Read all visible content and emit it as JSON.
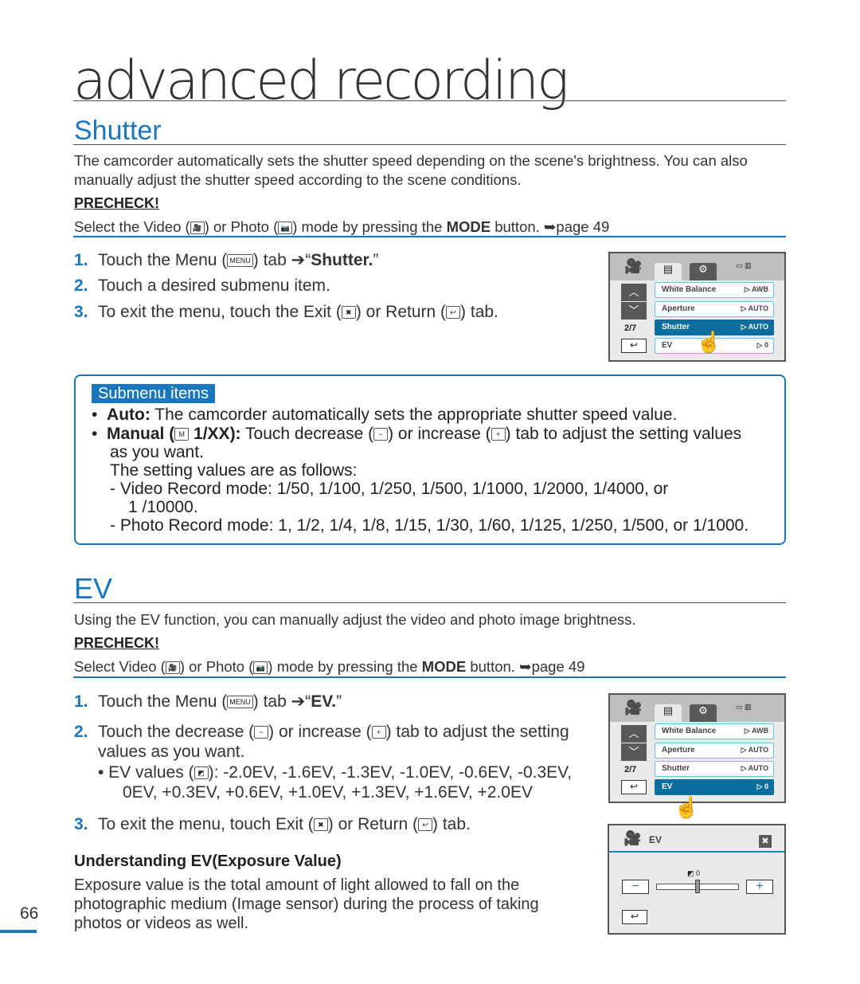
{
  "chapter_title": "advanced recording",
  "shutter": {
    "title": "Shutter",
    "intro": "The camcorder automatically sets the shutter speed depending on the scene's brightness. You can also manually adjust the shutter speed according to the scene conditions.",
    "precheck_label": "PRECHECK!",
    "precheck": {
      "a": "Select the Video (",
      "b": ") or Photo (",
      "c": ") mode by pressing the ",
      "mode": "MODE",
      "d": " button. ➥page 49"
    },
    "steps": [
      {
        "num": "1.",
        "a": "Touch the Menu (",
        "icon": "MENU",
        "b": ") tab ➔“",
        "bold": "Shutter.",
        "c": "”"
      },
      {
        "num": "2.",
        "text": "Touch a desired submenu item."
      },
      {
        "num": "3.",
        "a": "To exit the menu, touch the Exit (",
        "b": ") or Return (",
        "c": ") tab."
      }
    ],
    "submenu_label": "Submenu items",
    "auto_label": "Auto:",
    "auto_text": " The camcorder automatically sets the appropriate shutter speed value.",
    "manual_label": "Manual (",
    "manual_mid": " 1/XX):",
    "manual_text": " Touch decrease (",
    "manual_text2": ") or increase (",
    "manual_text3": ") tab to adjust the setting values",
    "manual_line2": "as you want.",
    "manual_line3": "The setting values are as follows:",
    "video_values": "-  Video Record mode: 1/50, 1/100, 1/250, 1/500, 1/1000, 1/2000, 1/4000, or",
    "video_values2": "1 /10000.",
    "photo_values": "-  Photo Record mode: 1, 1/2, 1/4, 1/8, 1/15, 1/30, 1/60, 1/125, 1/250, 1/500, or 1/1000."
  },
  "ev": {
    "title": "EV",
    "intro": "Using the EV function, you can manually adjust the video and photo image brightness.",
    "precheck_label": "PRECHECK!",
    "precheck": {
      "a": "Select Video (",
      "b": ") or Photo (",
      "c": ") mode by pressing the ",
      "mode": "MODE",
      "d": " button. ➥page 49"
    },
    "step1": {
      "num": "1.",
      "a": "Touch the Menu (",
      "icon": "MENU",
      "b": ") tab ➔“",
      "bold": "EV.",
      "c": "”"
    },
    "step2": {
      "num": "2.",
      "a": "Touch the decrease (",
      "b": ") or increase (",
      "c": ") tab to adjust the setting",
      "d": "values as you want."
    },
    "ev_values_a": "•   EV values (",
    "ev_values_b": "): -2.0EV, -1.6EV, -1.3EV, -1.0EV, -0.6EV, -0.3EV,",
    "ev_values_c": "0EV, +0.3EV, +0.6EV, +1.0EV, +1.3EV, +1.6EV, +2.0EV",
    "step3": {
      "num": "3.",
      "a": "To exit the menu, touch Exit (",
      "b": ") or Return (",
      "c": ") tab."
    },
    "understanding_title": "Understanding EV(Exposure Value)",
    "understanding_text": "Exposure value is the total amount of light allowed to fall on the photographic medium (Image sensor) during the process of taking photos or videos as well."
  },
  "screen": {
    "page": "2/7",
    "items": [
      {
        "label": "White Balance",
        "value": "▷ AWB"
      },
      {
        "label": "Aperture",
        "value": "▷ AUTO"
      },
      {
        "label": "Shutter",
        "value": "▷ AUTO"
      },
      {
        "label": "EV",
        "value": "▷ 0"
      }
    ],
    "ev_panel_title": "EV",
    "ev_value": "0",
    "ev_level": 0.5
  },
  "page_number": "66",
  "colors": {
    "accent": "#1a76bd",
    "selected_row": "#0b6e9e"
  }
}
